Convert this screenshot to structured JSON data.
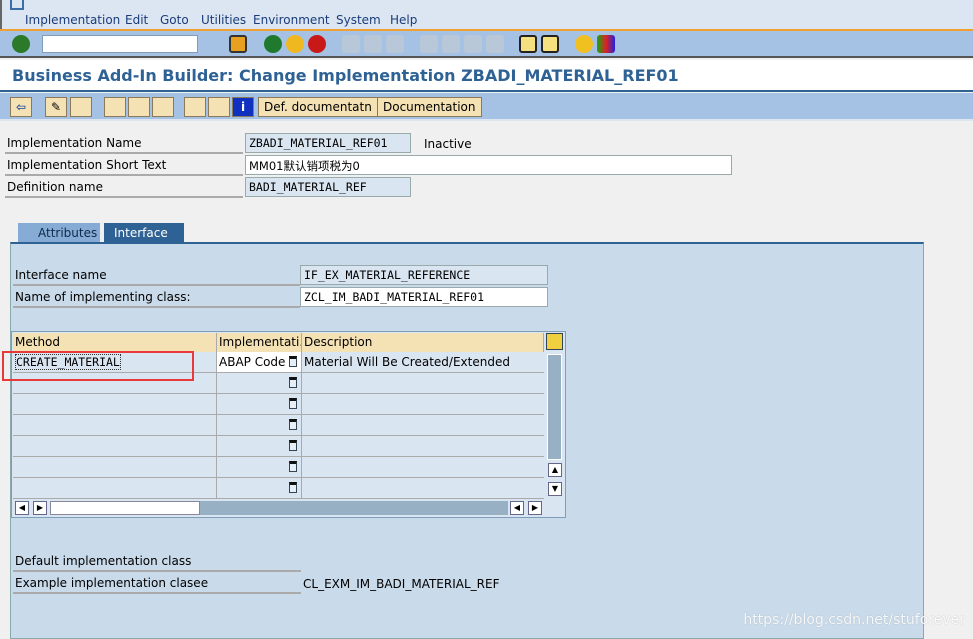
{
  "menu": [
    "Implementation",
    "Edit",
    "Goto",
    "Utilities",
    "Environment",
    "System",
    "Help"
  ],
  "title": "Business Add-In Builder: Change Implementation ZBADI_MATERIAL_REF01",
  "command_field": {
    "value": ""
  },
  "app_toolbar": {
    "def_doc": "Def. documentatn",
    "doc": "Documentation"
  },
  "header": {
    "impl_name_label": "Implementation Name",
    "impl_name": "ZBADI_MATERIAL_REF01",
    "status": "Inactive",
    "short_text_label": "Implementation Short Text",
    "short_text": "MM01默认销项税为0",
    "def_name_label": "Definition name",
    "def_name": "BADI_MATERIAL_REF"
  },
  "tabs": [
    {
      "label": "Attributes"
    },
    {
      "label": "Interface",
      "active": true
    }
  ],
  "interface": {
    "iface_label": "Interface name",
    "iface": "IF_EX_MATERIAL_REFERENCE",
    "class_label": "Name of implementing class:",
    "class": "ZCL_IM_BADI_MATERIAL_REF01"
  },
  "grid": {
    "columns": [
      "Method",
      "Implementati...",
      "Description"
    ],
    "rows": [
      {
        "method": "CREATE_MATERIAL",
        "impl": "ABAP Code",
        "desc": "Material Will Be Created/Extended"
      },
      {
        "method": "",
        "impl": "",
        "desc": ""
      },
      {
        "method": "",
        "impl": "",
        "desc": ""
      },
      {
        "method": "",
        "impl": "",
        "desc": ""
      },
      {
        "method": "",
        "impl": "",
        "desc": ""
      },
      {
        "method": "",
        "impl": "",
        "desc": ""
      },
      {
        "method": "",
        "impl": "",
        "desc": ""
      }
    ]
  },
  "footer": {
    "default_label": "Default implementation class",
    "default": "",
    "example_label": "Example implementation clasee",
    "example": "CL_EXM_IM_BADI_MATERIAL_REF"
  },
  "watermark": "https://blog.csdn.net/stuforever",
  "colors": {
    "toolbar": "#a5c2e4",
    "title": "#2f6294",
    "panel": "#c9daea",
    "highlight": "#e83a3a"
  }
}
